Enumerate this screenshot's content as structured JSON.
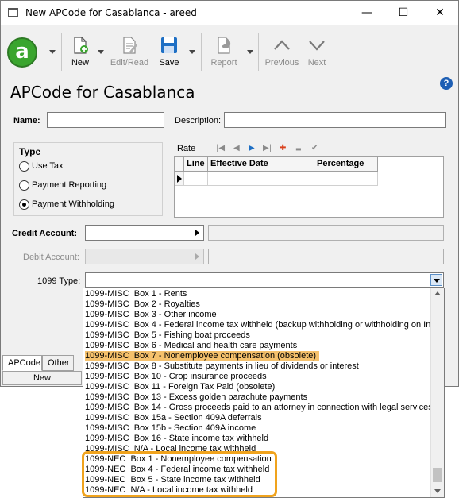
{
  "window": {
    "title": "New APCode for Casablanca - areed",
    "minimize_glyph": "—",
    "maximize_glyph": "☐",
    "close_glyph": "✕"
  },
  "toolbar": {
    "logo_letter": "a",
    "new_label": "New",
    "edit_read_label": "Edit/Read",
    "save_label": "Save",
    "report_label": "Report",
    "previous_label": "Previous",
    "next_label": "Next"
  },
  "page": {
    "title": "APCode for Casablanca",
    "help_glyph": "?"
  },
  "form": {
    "name_label": "Name:",
    "name_value": "",
    "description_label": "Description:",
    "description_value": "",
    "type_label": "Type",
    "type_options": [
      {
        "label": "Use Tax",
        "selected": false
      },
      {
        "label": "Payment Reporting",
        "selected": false
      },
      {
        "label": "Payment Withholding",
        "selected": true
      }
    ],
    "credit_account_label": "Credit Account:",
    "debit_account_label": "Debit Account:",
    "type_1099_label": "1099 Type:",
    "type_1099_value": ""
  },
  "rate_grid": {
    "label": "Rate",
    "nav_first": "|◀",
    "nav_prev": "◀",
    "nav_next": "▶",
    "nav_last": "▶|",
    "nav_add": "✚",
    "nav_remove": "▬",
    "nav_confirm": "✔",
    "columns": [
      "Line",
      "Effective Date",
      "Percentage"
    ]
  },
  "bottom": {
    "tabs": [
      "APCode",
      "Other"
    ],
    "status": "New"
  },
  "dropdown": {
    "selected_index": 6,
    "items": [
      "1099-MISC  Box 1 - Rents",
      "1099-MISC  Box 2 - Royalties",
      "1099-MISC  Box 3 - Other income",
      "1099-MISC  Box 4 - Federal income tax withheld (backup withholding or withholding on Ind",
      "1099-MISC  Box 5 - Fishing boat proceeds",
      "1099-MISC  Box 6 - Medical and health care payments",
      "1099-MISC  Box 7 - Nonemployee compensation (obsolete)",
      "1099-MISC  Box 8 - Substitute payments in lieu of dividends or interest",
      "1099-MISC  Box 10 - Crop insurance proceeds",
      "1099-MISC  Box 11 - Foreign Tax Paid (obsolete)",
      "1099-MISC  Box 13 - Excess golden parachute payments",
      "1099-MISC  Box 14 - Gross proceeds paid to an attorney in connection with legal services",
      "1099-MISC  Box 15a - Section 409A deferrals",
      "1099-MISC  Box 15b - Section 409A income",
      "1099-MISC  Box 16 - State income tax withheld",
      "1099-MISC  N/A - Local income tax withheld",
      "1099-NEC  Box 1 - Nonemployee compensation",
      "1099-NEC  Box 4 - Federal income tax withheld",
      "1099-NEC  Box 5 - State income tax withheld",
      "1099-NEC  N/A - Local income tax withheld"
    ]
  },
  "colors": {
    "accent_green": "#3aa52e",
    "save_blue": "#1e6fc4",
    "selection_orange": "#f5c16c",
    "highlight_border": "#f0a31d"
  }
}
